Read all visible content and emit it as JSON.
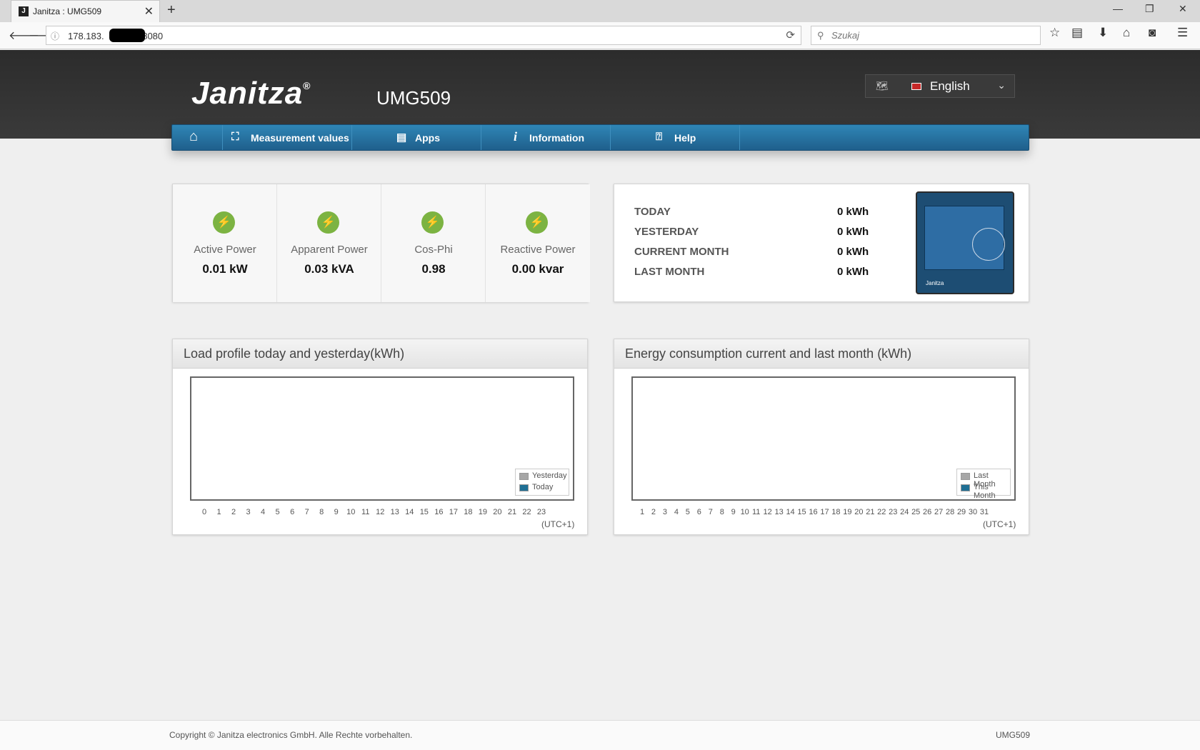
{
  "browser": {
    "tab_title": "Janitza : UMG509",
    "tab_favicon": "J",
    "url": "178.183.",
    "url_port": ":8080",
    "search_placeholder": "Szukaj"
  },
  "header": {
    "logo": "Janitza",
    "logo_mark": "®",
    "device": "UMG509",
    "language": "English"
  },
  "nav": {
    "home_icon": "home-icon",
    "items": [
      {
        "label": "Measurement values",
        "icon": "chart-icon"
      },
      {
        "label": "Apps",
        "icon": "apps-icon"
      },
      {
        "label": "Information",
        "icon": "info-icon"
      },
      {
        "label": "Help",
        "icon": "help-icon"
      }
    ]
  },
  "kpis": [
    {
      "name": "Active Power",
      "value": "0.01 kW"
    },
    {
      "name": "Apparent Power",
      "value": "0.03 kVA"
    },
    {
      "name": "Cos-Phi",
      "value": "0.98"
    },
    {
      "name": "Reactive Power",
      "value": "0.00 kvar"
    }
  ],
  "energy": [
    {
      "label": "TODAY",
      "value": "0 kWh"
    },
    {
      "label": "YESTERDAY",
      "value": "0 kWh"
    },
    {
      "label": "CURRENT MONTH",
      "value": "0 kWh"
    },
    {
      "label": "LAST MONTH",
      "value": "0 kWh"
    }
  ],
  "device_image": {
    "brand": "Janitza"
  },
  "charts": {
    "load_profile": {
      "title": "Load profile today and yesterday(kWh)",
      "legend": [
        {
          "name": "Yesterday",
          "color": "#a6a6a6"
        },
        {
          "name": "Today",
          "color": "#1f6f94"
        }
      ],
      "utc": "(UTC+1)"
    },
    "energy_month": {
      "title": "Energy consumption current and last month (kWh)",
      "legend": [
        {
          "name": "Last Month",
          "color": "#a6a6a6"
        },
        {
          "name": "This Month",
          "color": "#1f6f94"
        }
      ],
      "utc": "(UTC+1)"
    }
  },
  "chart_data": [
    {
      "type": "bar",
      "title": "Load profile today and yesterday(kWh)",
      "categories": [
        "0",
        "1",
        "2",
        "3",
        "4",
        "5",
        "6",
        "7",
        "8",
        "9",
        "10",
        "11",
        "12",
        "13",
        "14",
        "15",
        "16",
        "17",
        "18",
        "19",
        "20",
        "21",
        "22",
        "23"
      ],
      "series": [
        {
          "name": "Yesterday",
          "values": []
        },
        {
          "name": "Today",
          "values": []
        }
      ],
      "xlabel": "(UTC+1)",
      "ylabel": "",
      "legend": "bottom-right"
    },
    {
      "type": "bar",
      "title": "Energy consumption current and last month (kWh)",
      "categories": [
        "1",
        "2",
        "3",
        "4",
        "5",
        "6",
        "7",
        "8",
        "9",
        "10",
        "11",
        "12",
        "13",
        "14",
        "15",
        "16",
        "17",
        "18",
        "19",
        "20",
        "21",
        "22",
        "23",
        "24",
        "25",
        "26",
        "27",
        "28",
        "29",
        "30",
        "31"
      ],
      "series": [
        {
          "name": "Last Month",
          "values": []
        },
        {
          "name": "This Month",
          "values": []
        }
      ],
      "xlabel": "(UTC+1)",
      "ylabel": "",
      "legend": "bottom-right"
    }
  ],
  "footer": {
    "copyright": "Copyright © Janitza electronics GmbH. Alle Rechte vorbehalten.",
    "model": "UMG509"
  }
}
